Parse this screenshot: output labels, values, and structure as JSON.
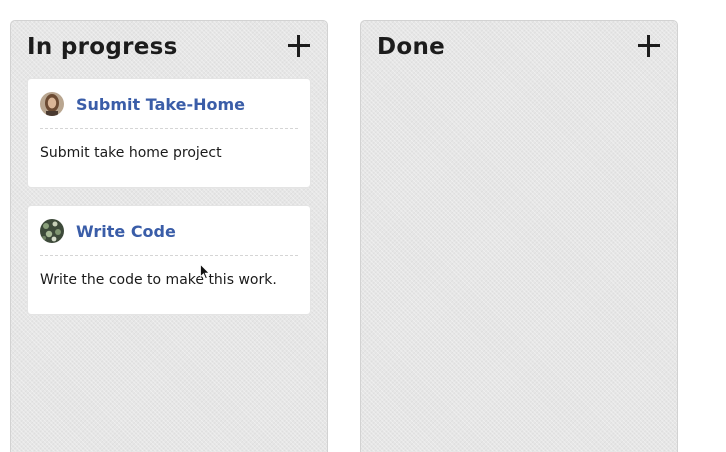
{
  "columns": [
    {
      "title": "In progress",
      "add_icon": "plus-icon",
      "cards": [
        {
          "title": "Submit Take-Home",
          "body": "Submit take home project",
          "avatar": "avatar-photo-person"
        },
        {
          "title": "Write Code",
          "body": "Write the code to make this work.",
          "avatar": "avatar-photo-texture"
        }
      ]
    },
    {
      "title": "Done",
      "add_icon": "plus-icon",
      "cards": []
    }
  ],
  "colors": {
    "card_title": "#3a5da8",
    "column_bg": "#e6e6e6",
    "heading": "#1c1c1c"
  }
}
